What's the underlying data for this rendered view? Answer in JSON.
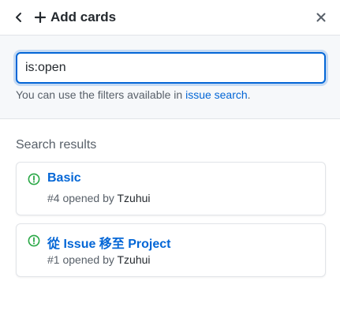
{
  "header": {
    "title": "Add cards",
    "back_icon": "chevron-left-icon",
    "add_icon": "plus-icon",
    "close_icon": "x-icon"
  },
  "filter": {
    "value": "is:open",
    "hint_prefix": "You can use the filters available in ",
    "hint_link": "issue search",
    "hint_suffix": "."
  },
  "results": {
    "label": "Search results",
    "items": [
      {
        "title": "Basic",
        "number": "#4",
        "opened_by_text": " opened by ",
        "author": "Tzuhui",
        "icon": "issue-opened-icon"
      },
      {
        "title": "從 Issue 移至 Project",
        "number": "#1",
        "opened_by_text": " opened by ",
        "author": "Tzuhui",
        "icon": "issue-opened-icon"
      }
    ]
  },
  "colors": {
    "accent": "#0366d6",
    "open_issue": "#28a745",
    "muted_text": "#586069",
    "border": "#e1e4e8",
    "filter_bg": "#f6f8fa"
  }
}
